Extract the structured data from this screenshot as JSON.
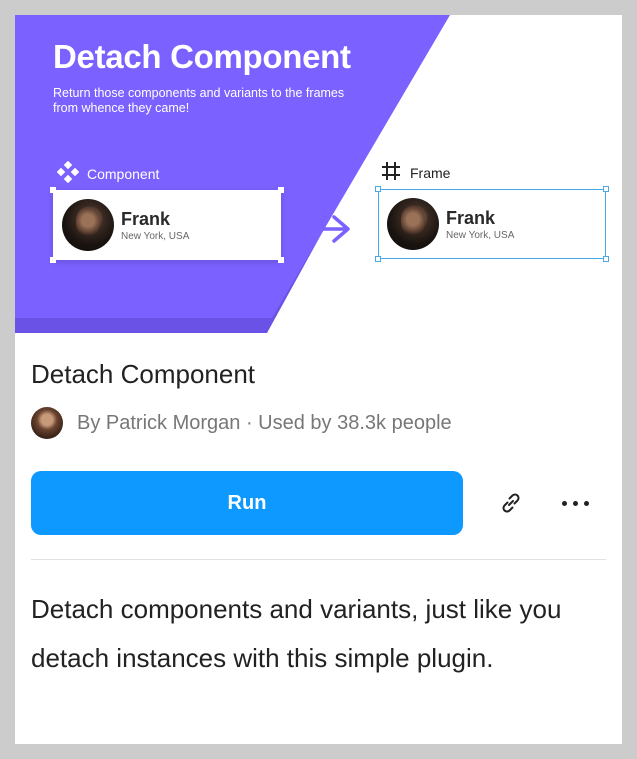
{
  "banner": {
    "title": "Detach Component",
    "subtitle": "Return those components and variants to the frames from whence they came!",
    "component_label": "Component",
    "frame_label": "Frame",
    "card_name": "Frank",
    "card_location": "New York, USA",
    "colors": {
      "purple": "#7b61ff",
      "purple_dark": "#6a52e6",
      "selection_blue": "#4aa8e6"
    }
  },
  "plugin": {
    "title": "Detach Component",
    "byline": "By Patrick Morgan · Used by 38.3k people",
    "run_label": "Run",
    "description": "Detach components and variants, just like you detach instances with this simple plugin.",
    "accent": "#0d99ff"
  },
  "icons": {
    "component": "component-icon",
    "frame": "frame-hash-icon",
    "arrow": "arrow-right-icon",
    "link": "link-icon",
    "more": "more-horizontal-icon"
  }
}
